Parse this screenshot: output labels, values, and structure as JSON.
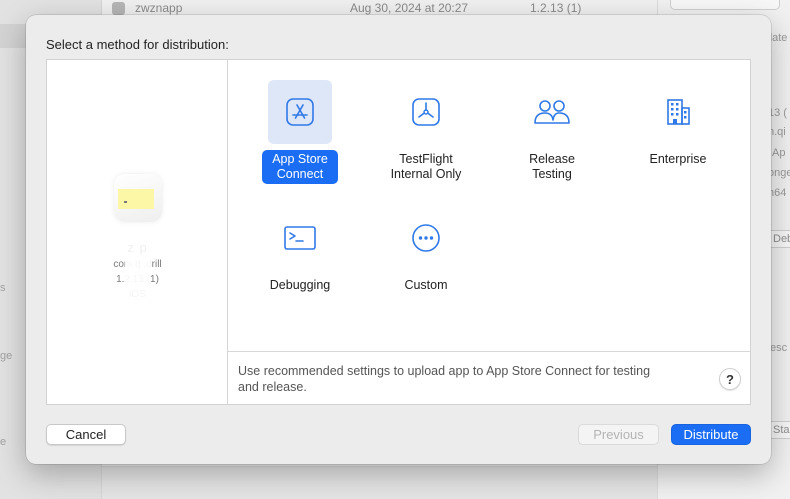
{
  "background": {
    "row": {
      "name": "zwznapp",
      "date": "Aug 30, 2024 at 20:27",
      "version": "1.2.13 (1)"
    },
    "right_fragments": [
      "date",
      "13 (",
      "n.qi",
      "Ap",
      "onge",
      "n64",
      "Deb",
      "esc",
      "Sta"
    ],
    "left_fragments": [
      "s",
      "ge",
      "e"
    ]
  },
  "dialog": {
    "title": "Select a method for distribution:",
    "app": {
      "name": "z    p",
      "bundle": "com.q     .drill",
      "version": "1.2.13 (1)",
      "platform": "iOS"
    },
    "options": [
      {
        "label": "App Store Connect",
        "icon": "app-store-icon",
        "selected": true
      },
      {
        "label": "TestFlight Internal Only",
        "icon": "testflight-icon",
        "selected": false
      },
      {
        "label": "Release Testing",
        "icon": "people-icon",
        "selected": false
      },
      {
        "label": "Enterprise",
        "icon": "building-icon",
        "selected": false
      },
      {
        "label": "Debugging",
        "icon": "terminal-icon",
        "selected": false
      },
      {
        "label": "Custom",
        "icon": "ellipsis-icon",
        "selected": false
      }
    ],
    "description": "Use recommended settings to upload app to App Store Connect for testing and release.",
    "help_label": "?",
    "buttons": {
      "cancel": "Cancel",
      "previous": "Previous",
      "distribute": "Distribute"
    },
    "colors": {
      "accent": "#1b6ef3",
      "selected_tile": "#dde7f7",
      "icon_blue": "#2f79e8"
    }
  }
}
